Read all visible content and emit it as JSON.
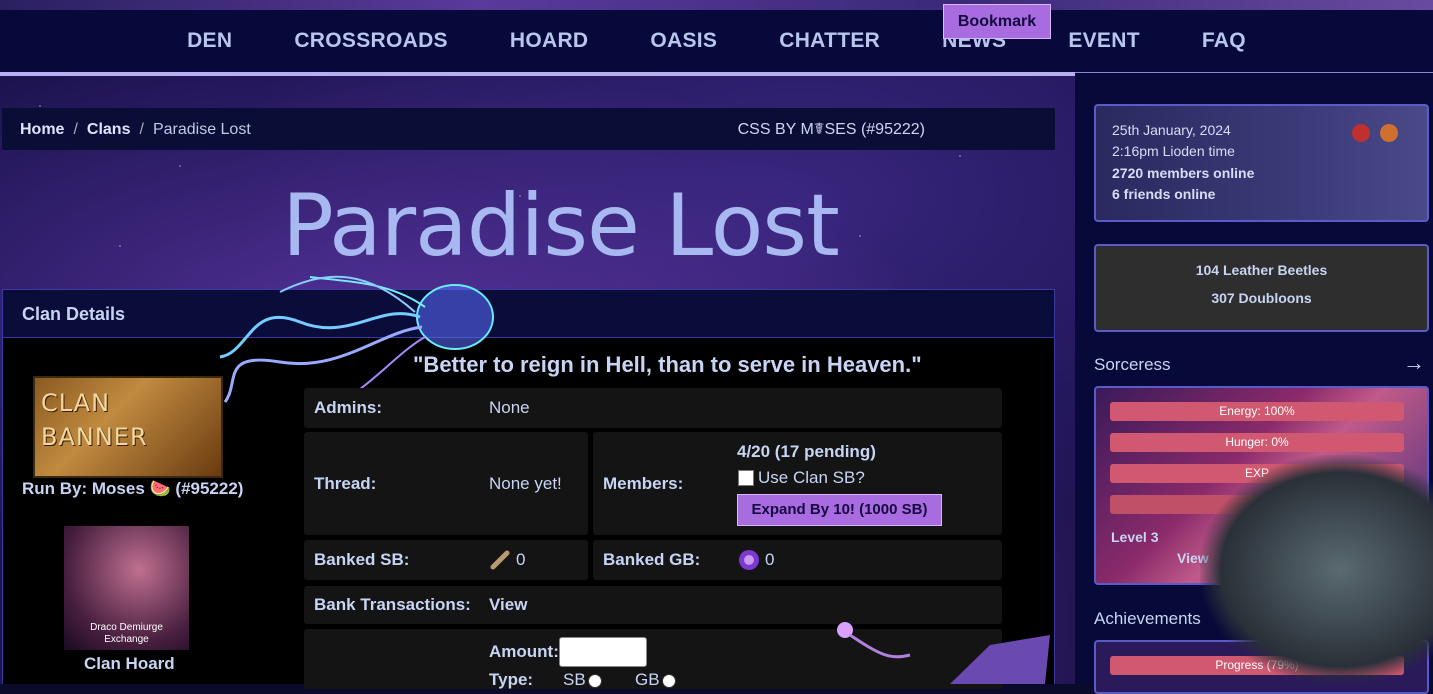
{
  "nav": {
    "items": [
      "DEN",
      "CROSSROADS",
      "HOARD",
      "OASIS",
      "CHATTER",
      "NEWS",
      "EVENT",
      "FAQ"
    ]
  },
  "breadcrumb": {
    "home": "Home",
    "clans": "Clans",
    "current": "Paradise Lost",
    "css_by": "CSS BY M☤SES (#95222)",
    "bookmark": "Bookmark"
  },
  "clan": {
    "title": "Paradise Lost",
    "details_header": "Clan Details",
    "motto": "\"Better to reign in Hell, than to serve in Heaven.\"",
    "banner_text_1": "CLAN",
    "banner_text_2": "BANNER",
    "run_by": "Run By: Moses 🍉 (#95222)",
    "hoard_image_text_1": "Draco Demiurge",
    "hoard_image_text_2": "Exchange",
    "hoard_label": "Clan Hoard"
  },
  "table": {
    "admins_label": "Admins:",
    "admins_value": "None",
    "thread_label": "Thread:",
    "thread_value": "None yet!",
    "members_label": "Members:",
    "members_value": "4/20 (17 pending)",
    "use_sb_label": "Use Clan SB?",
    "expand_button": "Expand By 10! (1000 SB)",
    "banked_sb_label": "Banked SB:",
    "banked_sb_value": "0",
    "banked_gb_label": "Banked GB:",
    "banked_gb_value": "0",
    "bank_transactions_label": "Bank Transactions:",
    "bank_transactions_link": "View",
    "amount_label": "Amount:",
    "type_label": "Type:",
    "type_sb": "SB",
    "type_gb": "GB"
  },
  "sidebar": {
    "date": "25th January, 2024",
    "time": "2:16pm Lioden time",
    "members_online": "2720 members online",
    "friends_online": "6 friends online",
    "beetles": "104 Leather Beetles",
    "doubloons": "307 Doubloons",
    "pet_name": "Sorceress",
    "arrow": "→",
    "energy": "Energy: 100%",
    "hunger": "Hunger: 0%",
    "exp": "EXP",
    "level": "Level 3",
    "view": "View",
    "achievements_title": "Achievements",
    "progress": "Progress (79%)"
  },
  "colors": {
    "nav_bg": "#06093a",
    "accent_purple": "#a86ce0",
    "bar_red": "#d05870",
    "text": "#c8d4f4"
  }
}
